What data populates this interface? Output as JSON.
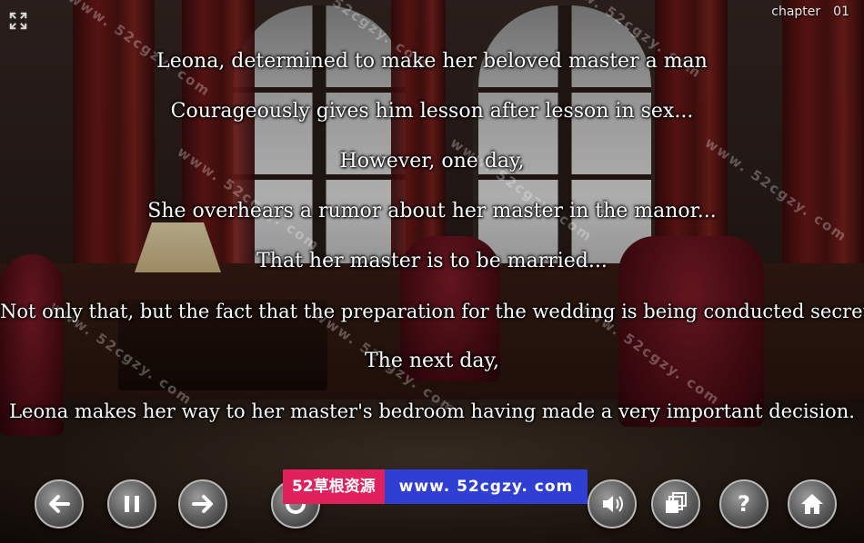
{
  "header": {
    "chapter_label": "chapter",
    "chapter_number": "01"
  },
  "story_lines": [
    "Leona, determined to make her beloved master a man",
    "Courageously gives him lesson after lesson in sex...",
    "However, one day,",
    "She overhears a rumor about her master in the manor...",
    "That her master is to be married...",
    "Not only that, but the fact that the preparation for the wedding is being conducted secretly.",
    "The next day,",
    "Leona makes her way to her master's bedroom having made a very important decision."
  ],
  "watermark": {
    "site_name": "52草根资源",
    "site_url": "www. 52cgzy. com",
    "diagonal_text": "www. 52cgzy. com"
  },
  "controls": {
    "buttons": [
      "back-icon",
      "pause-icon",
      "forward-icon",
      "auto-icon",
      "sound-icon",
      "skip-icon",
      "help-icon",
      "home-icon"
    ]
  },
  "colors": {
    "text": "#ffffff",
    "banner_pink": "#e0215b",
    "banner_blue": "#2f3fd4"
  }
}
